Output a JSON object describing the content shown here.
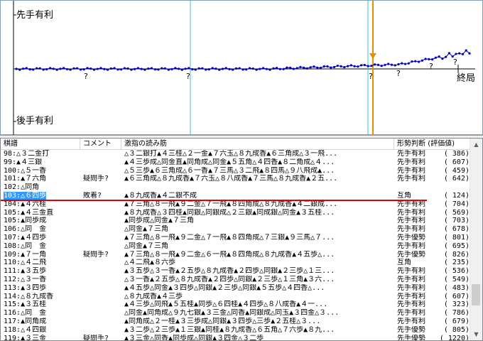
{
  "graph": {
    "label_top": "先手有利",
    "label_bottom": "後手有利",
    "label_end": "終局",
    "question_marks": [
      "?",
      "?",
      "?",
      "?",
      "?",
      "?"
    ],
    "colors": {
      "line": "#0000c0",
      "axis": "#000000",
      "cursor": "#e09000",
      "marker": "#40c0c0"
    }
  },
  "table": {
    "headers": [
      "棋譜",
      "コメント",
      "激指の読み筋",
      "形勢判断",
      "(評価値)"
    ],
    "selected_index": 5,
    "rows": [
      {
        "move": "98:△３二金打",
        "comment": "",
        "pv": "△３二銀打▲４三桂△２一金▲７六玉△８九成香▲６三角成△３一飛...",
        "judge": "先手有利",
        "value": "(    386)"
      },
      {
        "move": "99:▲４三銀",
        "comment": "",
        "pv": "▲４三歩成△同金直▲同角成△同金▲５五角△４四香▲８二角成△４...",
        "judge": "先手有利",
        "value": "(    607)"
      },
      {
        "move": "100:△５一香",
        "comment": "",
        "pv": "△５三歩▲６三角成△６一香▲７三馬△３二飛▲８四馬△９八飛成▲...",
        "judge": "先手有利",
        "value": "(    459)"
      },
      {
        "move": "101:▲７六角",
        "comment": "疑問手?",
        "pv": "▲６三角成△８九成香▲７六玉△８八成香▲７三馬△８九成香▲２五...",
        "judge": "先手有利",
        "value": "(    642)"
      },
      {
        "move": "102:△同角",
        "comment": "",
        "pv": "",
        "judge": "",
        "value": ""
      },
      {
        "move": "103:△６四歩",
        "comment": "敗着?",
        "pv": "▲８九成香▲４二銀不成",
        "judge": "互角",
        "value": "(    124)"
      },
      {
        "move": "104:▲４六桂",
        "comment": "",
        "pv": "▲７三角△８一飛▲９二金△７一飛▲８四角成△８九成香▲４二銀成...",
        "judge": "先手有利",
        "value": "(    704)"
      },
      {
        "move": "105:▲４三金直",
        "comment": "",
        "pv": "▲８九成香△３四桂▲同銀△同銀成△２三銀▲同成銀△同金▲３五桂...",
        "judge": "先手有利",
        "value": "(    569)"
      },
      {
        "move": "105:▲同歩成",
        "comment": "",
        "pv": "▲同歩成△同金▲７三角",
        "judge": "先手有利",
        "value": "(    703)"
      },
      {
        "move": "106:△同　金",
        "comment": "",
        "pv": "△同金▲７三角",
        "judge": "先手有利",
        "value": "(    678)"
      },
      {
        "move": "107:▲４四歩",
        "comment": "",
        "pv": "▲７三角△８一飛▲９二金△７一飛▲８四角成△７三銀▲９三馬△７...",
        "judge": "先手優勢",
        "value": "(    801)"
      },
      {
        "move": "108:△同　金",
        "comment": "",
        "pv": "△同金▲７三角",
        "judge": "先手有利",
        "value": "(    695)"
      },
      {
        "move": "109:▲７一角",
        "comment": "疑問手?",
        "pv": "▲７三角△８一飛▲９二金△６一飛▲８四角成△８九成香▲４五歩△...",
        "judge": "先手優勢",
        "value": "(    826)"
      },
      {
        "move": "110:△４二飛",
        "comment": "",
        "pv": "△４二飛▲８六歩",
        "judge": "互角",
        "value": "(    235)"
      },
      {
        "move": "111:▲３五歩",
        "comment": "",
        "pv": "▲３五歩△３一香▲２五歩△８九成香▲２四歩△同銀▲２三歩△１三...",
        "judge": "先手有利",
        "value": "(    536)"
      },
      {
        "move": "112:△３一香",
        "comment": "",
        "pv": "△３一香▲２五歩△８九成香▲２四歩△同銀▲２三歩△１三角▲３六...",
        "judge": "先手有利",
        "value": "(    549)"
      },
      {
        "move": "113:▲３四歩",
        "comment": "",
        "pv": "▲４五歩△同金▲３四歩△同銀▲２三歩△同銀▲５五歩△４四香△...",
        "judge": "先手有利",
        "value": "(    483)"
      },
      {
        "move": "114:△８九成香",
        "comment": "",
        "pv": "△８九成香▲４三歩",
        "judge": "先手有利",
        "value": "(    607)"
      },
      {
        "move": "115:▲３五桂",
        "comment": "",
        "pv": "▲４三歩△同飛▲５五桂▲同歩△６四桂▲４四歩△８八成香▲４一...",
        "judge": "先手有利",
        "value": "(    323)"
      },
      {
        "move": "116:△同　金",
        "comment": "",
        "pv": "△同金▲同角成△９九七銀▲３三金△同香▲同銀成△同玉▲３四金△３...",
        "judge": "先手有利",
        "value": "(    786)"
      },
      {
        "move": "117:▲同角成",
        "comment": "",
        "pv": "▲同角成△２一桂▲３三歩成△同銀▲３四歩△三歩▲２五桂△３...",
        "judge": "先手有利",
        "value": "(    679)"
      },
      {
        "move": "118:△４四銀",
        "comment": "",
        "pv": "▲３二歩△２三歩▲１三銀▲同桂▲８九成香△６五角△７六歩▲８九...",
        "judge": "先手優勢",
        "value": "(    805)"
      },
      {
        "move": "119:▲３三金",
        "comment": "疑問手?",
        "pv": "▲３三金△同香▲同歩成△同銀▲３四金△３二歩",
        "judge": "先手優勢",
        "value": "(   1220)"
      }
    ]
  }
}
